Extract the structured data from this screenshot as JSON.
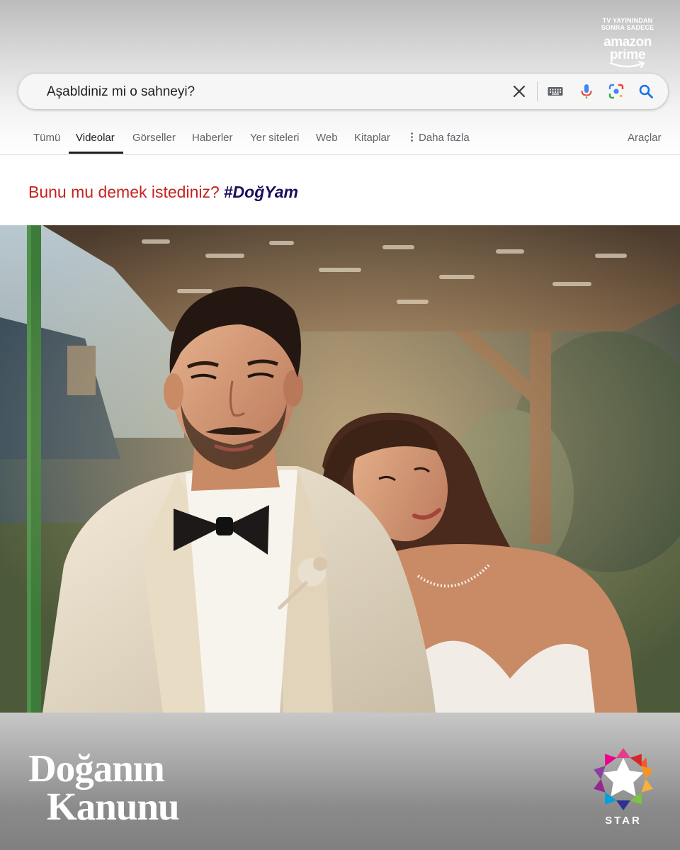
{
  "prime_badge": {
    "line1": "TV YAYININDAN",
    "line2": "SONRA SADECE",
    "brand_top": "amazon",
    "brand_bottom": "prime"
  },
  "search": {
    "query": "Aşabldiniz mi o sahneyi?",
    "icons": [
      "close-icon",
      "keyboard-icon",
      "microphone-icon",
      "lens-icon",
      "search-icon"
    ]
  },
  "tabs": {
    "items": [
      {
        "label": "Tümü",
        "active": false
      },
      {
        "label": "Videolar",
        "active": true
      },
      {
        "label": "Görseller",
        "active": false
      },
      {
        "label": "Haberler",
        "active": false
      },
      {
        "label": "Yer siteleri",
        "active": false
      },
      {
        "label": "Web",
        "active": false
      },
      {
        "label": "Kitaplar",
        "active": false
      }
    ],
    "more_label": "Daha fazla",
    "tools_label": "Araçlar"
  },
  "suggestion": {
    "prompt": "Bunu mu demek istediniz?",
    "term": "#DoğYam"
  },
  "show_logo": {
    "line1": "Doğanın",
    "line2": "Kanunu"
  },
  "channel_logo": {
    "label": "STAR"
  },
  "colors": {
    "suggestion_prompt": "#c5221f",
    "suggestion_term": "#1a0e5c",
    "mic_blue": "#4285f4",
    "mic_red": "#ea4335",
    "search_blue": "#1a73e8"
  }
}
